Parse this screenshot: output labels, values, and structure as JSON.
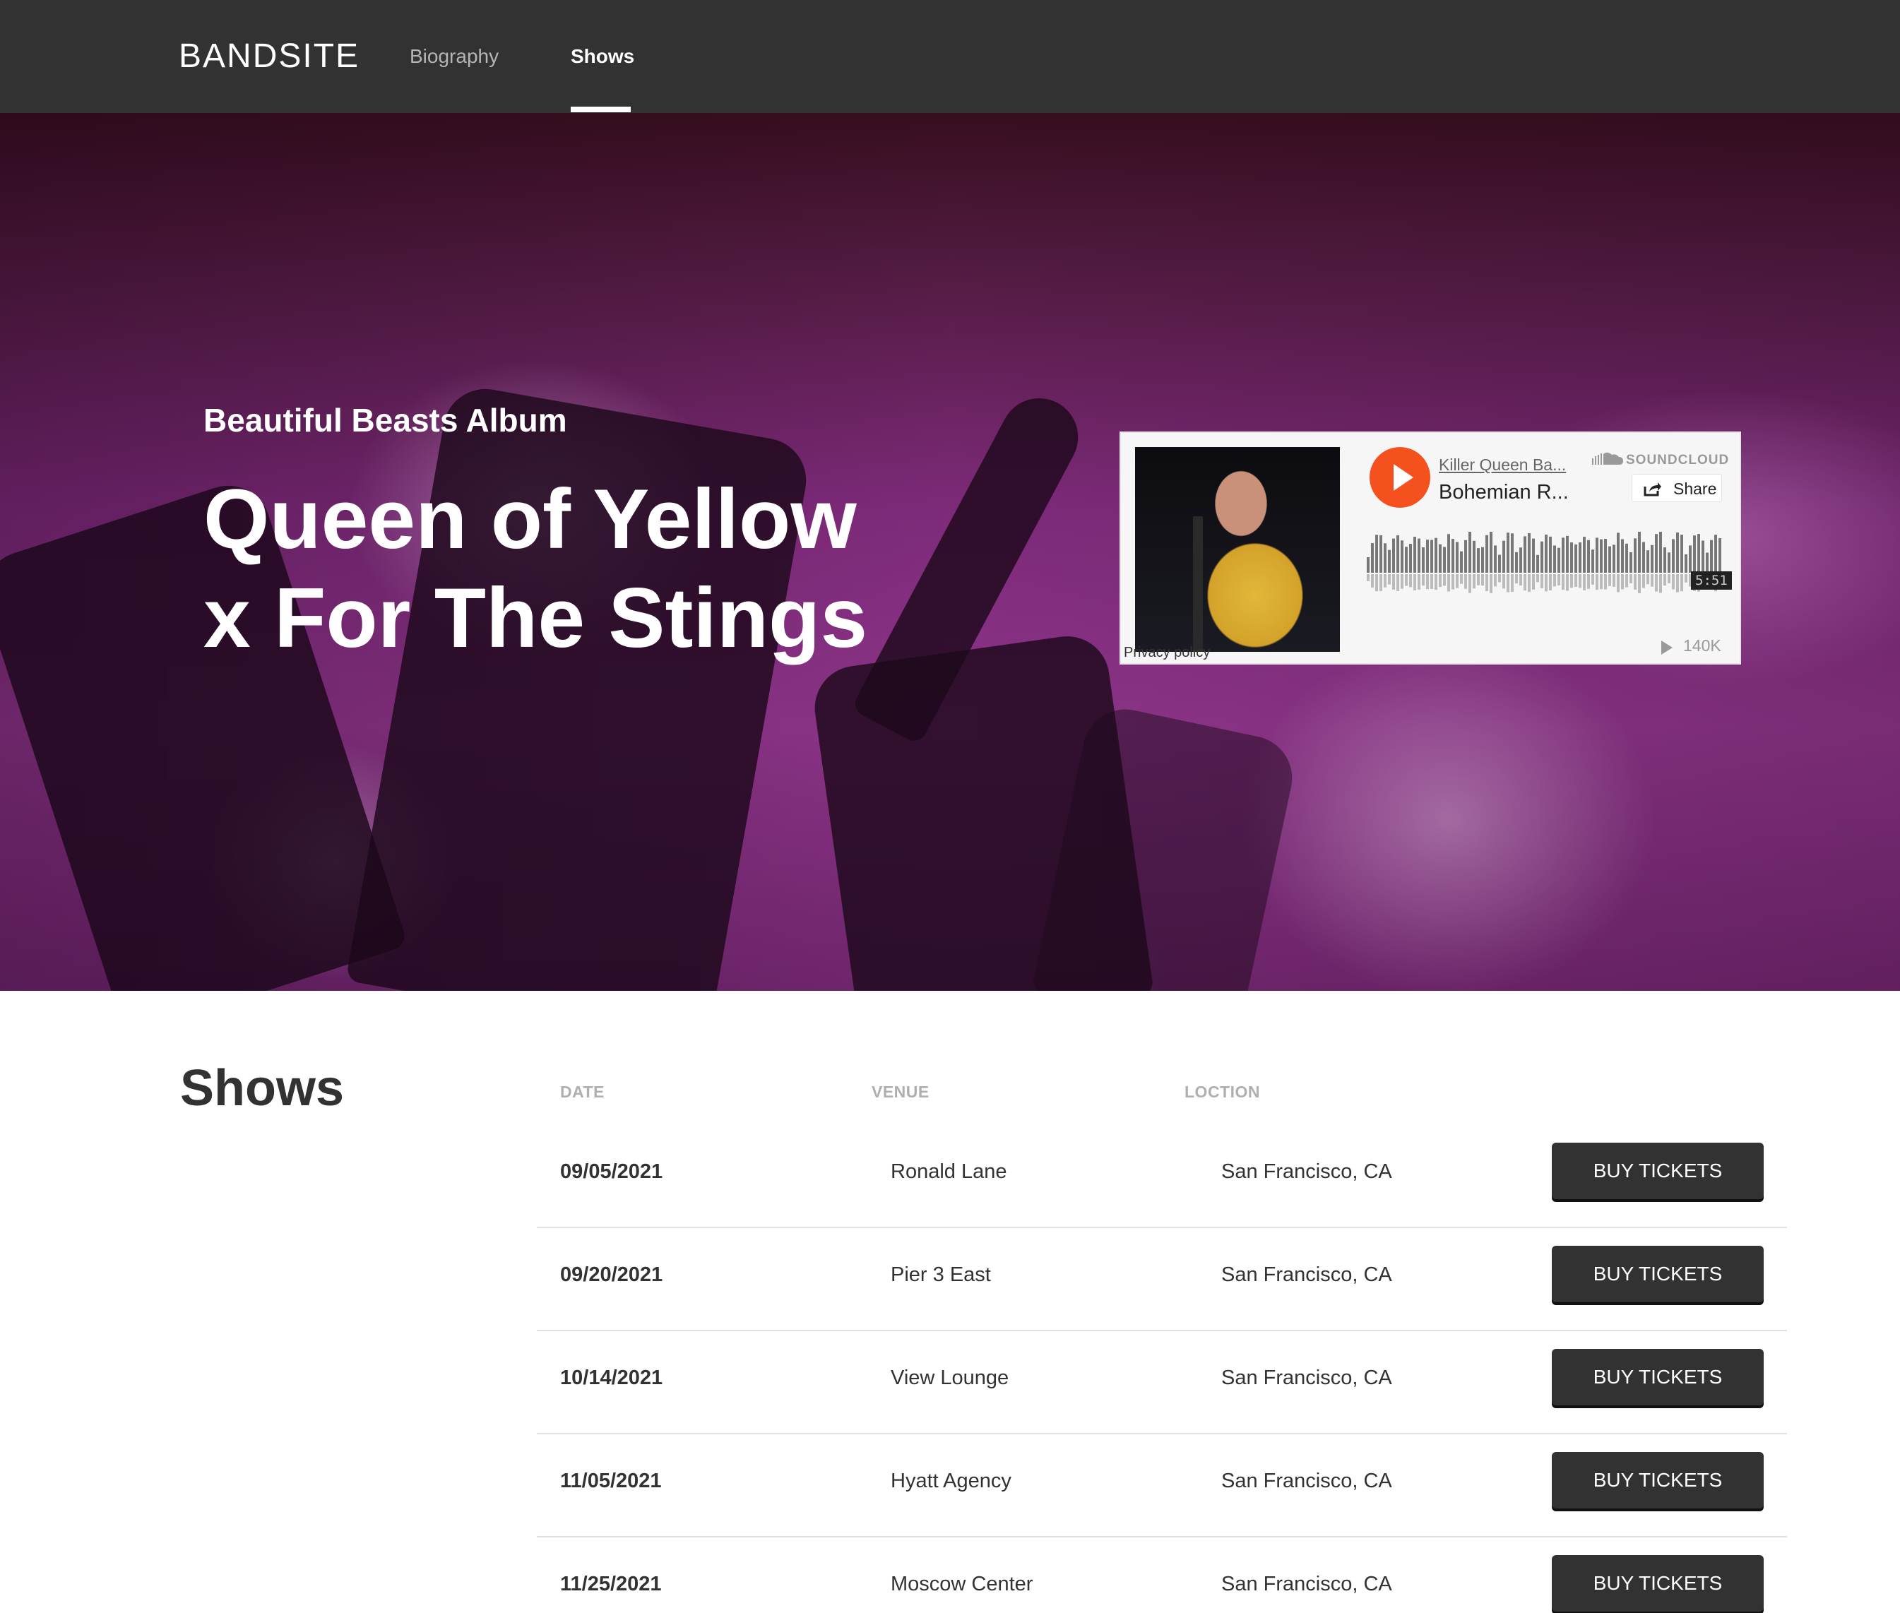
{
  "header": {
    "logo": "BANDSITE",
    "nav": [
      {
        "label": "Biography",
        "active": false
      },
      {
        "label": "Shows",
        "active": true
      }
    ]
  },
  "hero": {
    "album_label": "Beautiful Beasts Album",
    "title_line1": "Queen of Yellow",
    "title_line2": "x For The Stings"
  },
  "soundcloud": {
    "artist": "Killer Queen Ba...",
    "track": "Bohemian R...",
    "brand": "SOUNDCLOUD",
    "share_label": "Share",
    "duration": "5:51",
    "plays": "140K",
    "privacy": "Privacy policy",
    "accent_color": "#f4511e"
  },
  "shows": {
    "heading": "Shows",
    "columns": [
      "DATE",
      "VENUE",
      "LOCTION"
    ],
    "button_label": "BUY TICKETS",
    "rows": [
      {
        "date": "09/05/2021",
        "venue": "Ronald Lane",
        "location": "San Francisco, CA"
      },
      {
        "date": "09/20/2021",
        "venue": "Pier 3 East",
        "location": "San Francisco, CA"
      },
      {
        "date": "10/14/2021",
        "venue": "View Lounge",
        "location": "San Francisco, CA"
      },
      {
        "date": "11/05/2021",
        "venue": "Hyatt Agency",
        "location": "San Francisco, CA"
      },
      {
        "date": "11/25/2021",
        "venue": "Moscow Center",
        "location": "San Francisco, CA"
      }
    ]
  },
  "colors": {
    "header_bg": "#323232",
    "button_bg": "#323232",
    "hero_tint": "#9b3a96"
  }
}
